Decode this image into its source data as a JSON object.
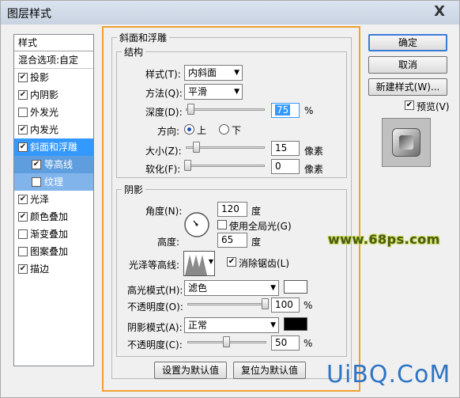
{
  "window": {
    "title": "图层样式",
    "close_glyph": "X"
  },
  "sidebar": {
    "header": "样式",
    "blend_options": "混合选项:自定",
    "items": [
      {
        "label": "投影",
        "checked": true
      },
      {
        "label": "内阴影",
        "checked": true
      },
      {
        "label": "外发光",
        "checked": false
      },
      {
        "label": "内发光",
        "checked": true
      },
      {
        "label": "斜面和浮雕",
        "checked": true,
        "selected": true
      },
      {
        "label": "等高线",
        "checked": true,
        "sub": true
      },
      {
        "label": "纹理",
        "checked": false,
        "sub": true
      },
      {
        "label": "光泽",
        "checked": true
      },
      {
        "label": "颜色叠加",
        "checked": true
      },
      {
        "label": "渐变叠加",
        "checked": false
      },
      {
        "label": "图案叠加",
        "checked": false
      },
      {
        "label": "描边",
        "checked": true
      }
    ]
  },
  "bevel": {
    "section_title": "斜面和浮雕",
    "structure": {
      "title": "结构",
      "style_label": "样式(T):",
      "style_value": "内斜面",
      "technique_label": "方法(Q):",
      "technique_value": "平滑",
      "depth_label": "深度(D):",
      "depth_value": "75",
      "depth_unit": "%",
      "direction_label": "方向:",
      "direction_up": "上",
      "direction_down": "下",
      "size_label": "大小(Z):",
      "size_value": "15",
      "size_unit": "像素",
      "soften_label": "软化(F):",
      "soften_value": "0",
      "soften_unit": "像素"
    },
    "shading": {
      "title": "阴影",
      "angle_label": "角度(N):",
      "angle_value": "120",
      "angle_unit": "度",
      "global_light_label": "使用全局光(G)",
      "altitude_label": "高度:",
      "altitude_value": "65",
      "altitude_unit": "度",
      "gloss_contour_label": "光泽等高线:",
      "antialias_label": "消除锯齿(L)",
      "highlight_mode_label": "高光模式(H):",
      "highlight_mode_value": "滤色",
      "highlight_opacity_label": "不透明度(O):",
      "highlight_opacity_value": "100",
      "highlight_color": "#ffffff",
      "shadow_mode_label": "阴影模式(A):",
      "shadow_mode_value": "正常",
      "shadow_opacity_label": "不透明度(C):",
      "shadow_opacity_value": "50",
      "shadow_color": "#000000",
      "percent": "%"
    },
    "make_default": "设置为默认值",
    "reset_default": "复位为默认值"
  },
  "actions": {
    "ok": "确定",
    "cancel": "取消",
    "new_style": "新建样式(W)...",
    "preview": "预览(V)"
  },
  "watermarks": {
    "site1": "www.68ps.com",
    "site2": "UiBQ.CoM"
  }
}
